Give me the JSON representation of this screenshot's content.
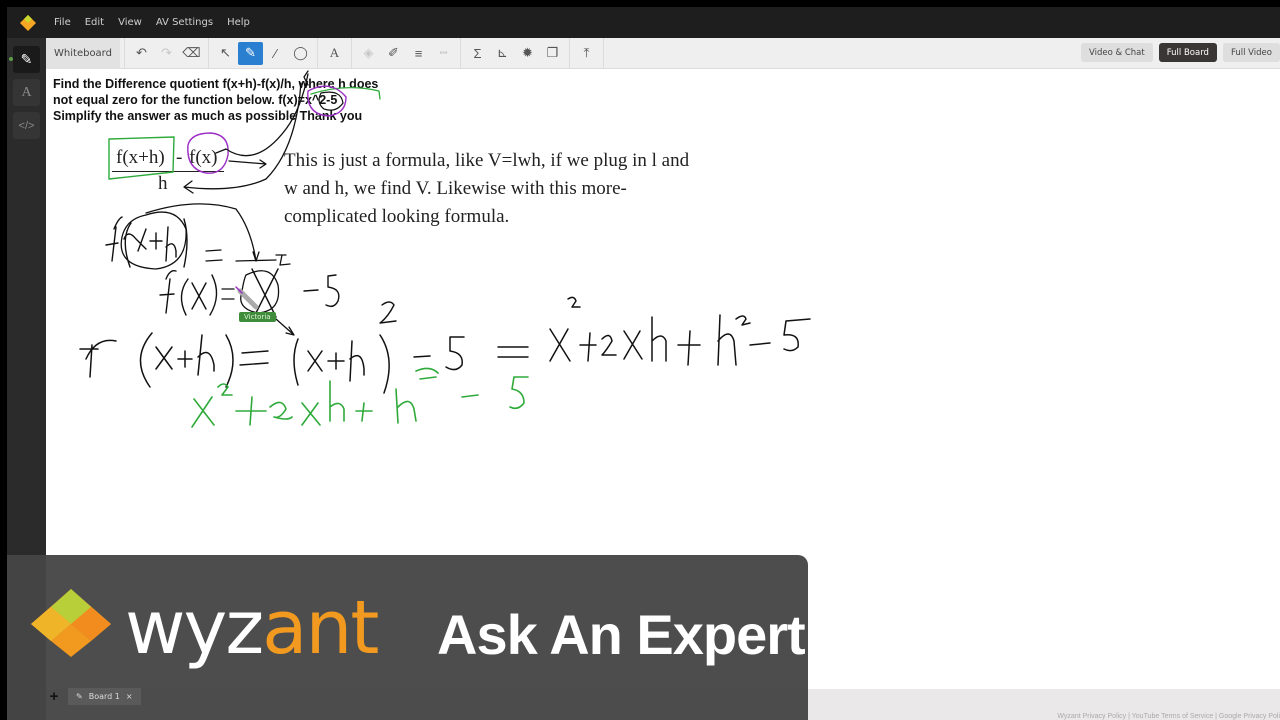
{
  "menu": {
    "items": [
      "File",
      "Edit",
      "View",
      "AV Settings",
      "Help"
    ]
  },
  "rail": {
    "buttons": [
      {
        "icon": "whiteboard-icon",
        "glyph": "✎",
        "active": true
      },
      {
        "icon": "text-icon",
        "glyph": "A",
        "active": false
      },
      {
        "icon": "code-icon",
        "glyph": "</>",
        "active": false
      }
    ]
  },
  "toolbar": {
    "tab_label": "Whiteboard",
    "tools": [
      {
        "name": "undo",
        "glyph": "↶",
        "state": "enabled"
      },
      {
        "name": "redo",
        "glyph": "↷",
        "state": "disabled"
      },
      {
        "name": "eraser",
        "glyph": "⌫",
        "state": "enabled"
      },
      {
        "name": "select",
        "glyph": "↖",
        "state": "enabled"
      },
      {
        "name": "pen",
        "glyph": "✎",
        "state": "active"
      },
      {
        "name": "line",
        "glyph": "∕",
        "state": "enabled"
      },
      {
        "name": "shape",
        "glyph": "◯",
        "state": "enabled"
      },
      {
        "name": "text",
        "glyph": "A",
        "state": "enabled"
      },
      {
        "name": "fill-color",
        "glyph": "◈",
        "state": "disabled"
      },
      {
        "name": "stroke-color",
        "glyph": "✐",
        "state": "enabled"
      },
      {
        "name": "line-width",
        "glyph": "≡",
        "state": "enabled"
      },
      {
        "name": "line-style",
        "glyph": "┅",
        "state": "disabled"
      },
      {
        "name": "equation",
        "glyph": "Σ",
        "state": "enabled"
      },
      {
        "name": "graph",
        "glyph": "⊾",
        "state": "enabled"
      },
      {
        "name": "settings",
        "glyph": "✹",
        "state": "enabled"
      },
      {
        "name": "layers",
        "glyph": "❐",
        "state": "enabled"
      },
      {
        "name": "upload",
        "glyph": "⤒",
        "state": "enabled"
      }
    ],
    "view_buttons": [
      {
        "label": "Video & Chat",
        "active": false
      },
      {
        "label": "Full Board",
        "active": true
      },
      {
        "label": "Full Video",
        "active": false
      }
    ]
  },
  "canvas": {
    "question": "Find the Difference quotient f(x+h)-f(x)/h, where h does not equal zero for the function below. f(x)=x^2-5 Simplify the answer as much as possible Thank you",
    "formula_numerator_left": "f(x+h)",
    "formula_minus": "-",
    "formula_numerator_right": "f(x)",
    "formula_denominator": "h",
    "note": "This is just a formula, like V=lwh, if we plug in l and w and h, we find V.  Likewise with this more-complicated looking formula.",
    "handwriting": [
      {
        "text": "f(x+h) = ",
        "color": "#111111"
      },
      {
        "text": "f(x) = x^2 - 5",
        "color": "#111111"
      },
      {
        "text": "f(x+h) = (x+h)^2 - 5 = x^2 + 2xh + h^2 - 5",
        "color": "#111111"
      },
      {
        "text": "x^2 + 2xh + h^2 - 5",
        "color": "#2eaa3a"
      }
    ],
    "cursor_user": "Victoria",
    "ink_colors": {
      "black": "#111111",
      "green": "#2eaa3a",
      "purple": "#9b2fc4"
    }
  },
  "boards": {
    "add_label": "+",
    "tabs": [
      {
        "label": "Board 1",
        "close": "×"
      }
    ]
  },
  "footer": {
    "links": "Wyzant Privacy Policy  |  YouTube Terms of Service  |  Google Privacy Poli"
  },
  "banner": {
    "brand_main": "wyz",
    "brand_accent": "ant",
    "tagline": "Ask An Expert",
    "accent_color": "#f29a1f"
  }
}
